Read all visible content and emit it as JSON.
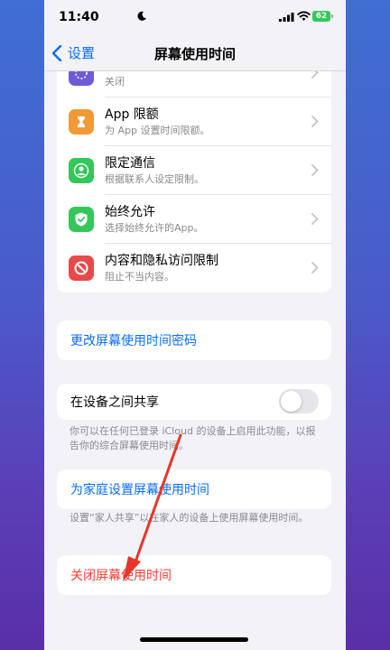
{
  "status_bar": {
    "time": "11:40",
    "battery": "62"
  },
  "nav": {
    "back_label": "设置",
    "title": "屏幕使用时间"
  },
  "settings_items": [
    {
      "title": "",
      "subtitle": "关闭",
      "icon": "hourglass-icon",
      "color": "#6e5bd6"
    },
    {
      "title": "App 限额",
      "subtitle": "为 App 设置时间限额。",
      "icon": "hourglass-icon",
      "color": "#f09a37"
    },
    {
      "title": "限定通信",
      "subtitle": "根据联系人设定限制。",
      "icon": "person-icon",
      "color": "#34c759"
    },
    {
      "title": "始终允许",
      "subtitle": "选择始终允许的App。",
      "icon": "checkmark-icon",
      "color": "#34c759"
    },
    {
      "title": "内容和隐私访问限制",
      "subtitle": "阻止不当内容。",
      "icon": "restriction-icon",
      "color": "#e84a4a"
    }
  ],
  "change_passcode_label": "更改屏幕使用时间密码",
  "share": {
    "label": "在设备之间共享",
    "footnote": "你可以在任何已登录 iCloud 的设备上启用此功能，以报告你的综合屏幕使用时间。"
  },
  "family": {
    "label": "为家庭设置屏幕使用时间",
    "footnote": "设置“家人共享”以在家人的设备上使用屏幕使用时间。"
  },
  "turn_off_label": "关闭屏幕使用时间",
  "colors": {
    "accent": "#0a6cff",
    "destructive": "#ff3b30"
  }
}
